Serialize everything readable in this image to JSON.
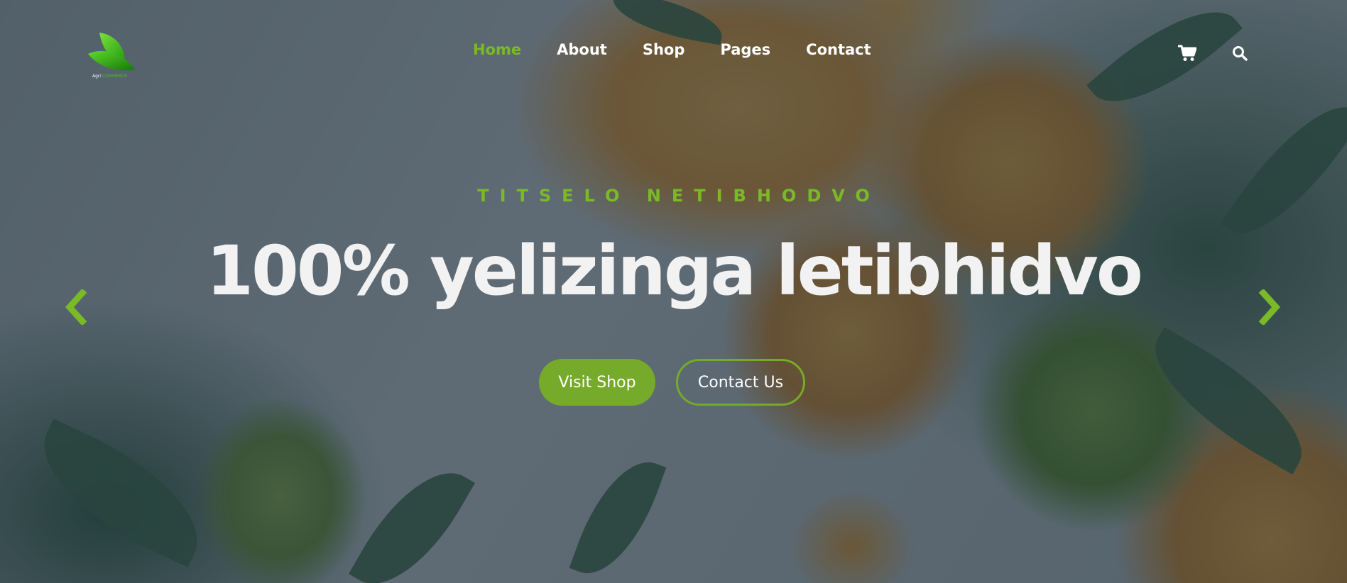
{
  "logo": {
    "text_prefix": "Agri",
    "text_suffix": "COMMERCE",
    "icon": "leaf-logo-icon"
  },
  "nav": {
    "items": [
      {
        "label": "Home",
        "active": true
      },
      {
        "label": "About",
        "active": false
      },
      {
        "label": "Shop",
        "active": false
      },
      {
        "label": "Pages",
        "active": false
      },
      {
        "label": "Contact",
        "active": false
      }
    ]
  },
  "header_icons": {
    "cart": "cart-icon",
    "search": "search-icon"
  },
  "hero": {
    "eyebrow": "TITSELO NETIBHODVO",
    "headline": "100% yelizinga letibhidvo",
    "primary_button": "Visit Shop",
    "secondary_button": "Contact Us",
    "prev_icon": "chevron-left-icon",
    "next_icon": "chevron-right-icon"
  },
  "colors": {
    "accent": "#7ab928",
    "button": "#76aa2a",
    "text": "#ffffff",
    "overlay": "#26374488"
  }
}
